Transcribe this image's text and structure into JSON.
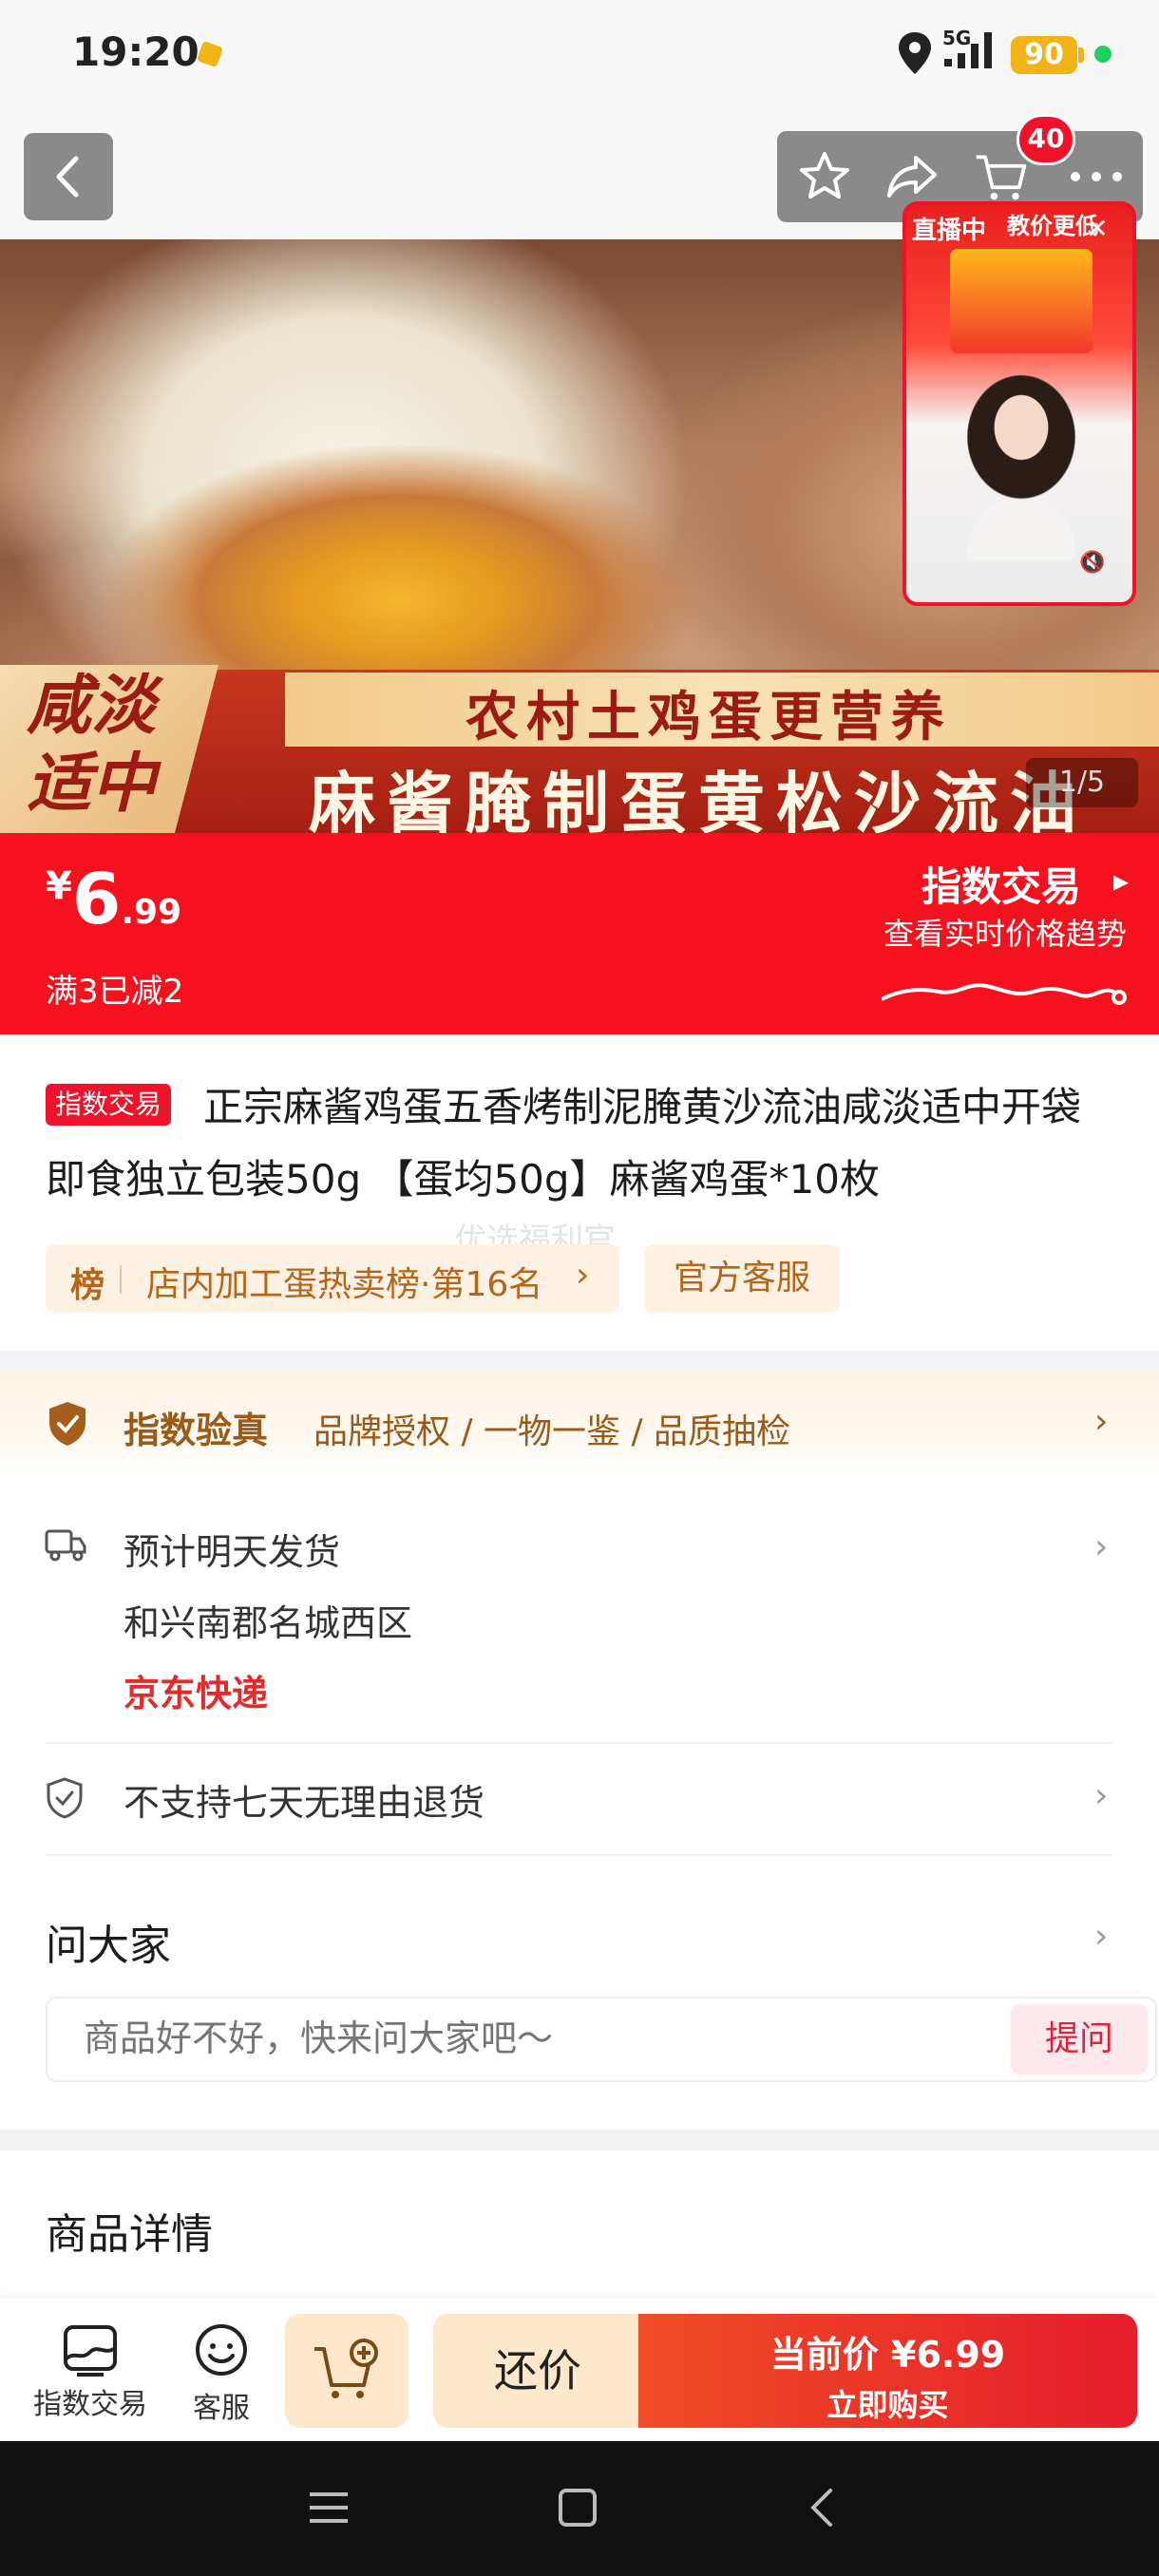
{
  "status_bar": {
    "time": "19:20",
    "network": "5G",
    "battery": "90"
  },
  "nav": {
    "cart_badge": "40"
  },
  "hero": {
    "side_text": "咸淡\n适中",
    "line1": "农村土鸡蛋更营养",
    "line2": "麻酱腌制蛋黄松沙流油",
    "page_indicator": "1/5"
  },
  "live": {
    "label": "直播中",
    "title": "教价更低"
  },
  "price_banner": {
    "currency": "¥",
    "price_int": "6",
    "price_dec": ".99",
    "promo": "满3已减2",
    "index_link": "指数交易",
    "index_sub": "查看实时价格趋势",
    "accent": "#f5121e"
  },
  "product": {
    "tag": "指数交易",
    "title": "正宗麻酱鸡蛋五香烤制泥腌黄沙流油咸淡适中开袋即食独立包装50g 【蛋均50g】麻酱鸡蛋*10枚",
    "watermark": "优选福利官",
    "rank_label": "榜",
    "rank_text": "店内加工蛋热卖榜·第16名",
    "service_chip": "官方客服"
  },
  "verify": {
    "title": "指数验真",
    "desc": "品牌授权 / 一物一鉴 / 品质抽检"
  },
  "shipping": {
    "line1": "预计明天发货",
    "line2": "和兴南郡名城西区",
    "courier": "京东快递"
  },
  "returns": {
    "text": "不支持七天无理由退货"
  },
  "ask": {
    "title": "问大家",
    "placeholder": "商品好不好，快来问大家吧～",
    "button": "提问"
  },
  "details": {
    "title": "商品详情"
  },
  "bottom_bar": {
    "index_label": "指数交易",
    "service_label": "客服",
    "haggle": "还价",
    "buy_line1": "当前价 ¥6.99",
    "buy_line2": "立即购买"
  }
}
